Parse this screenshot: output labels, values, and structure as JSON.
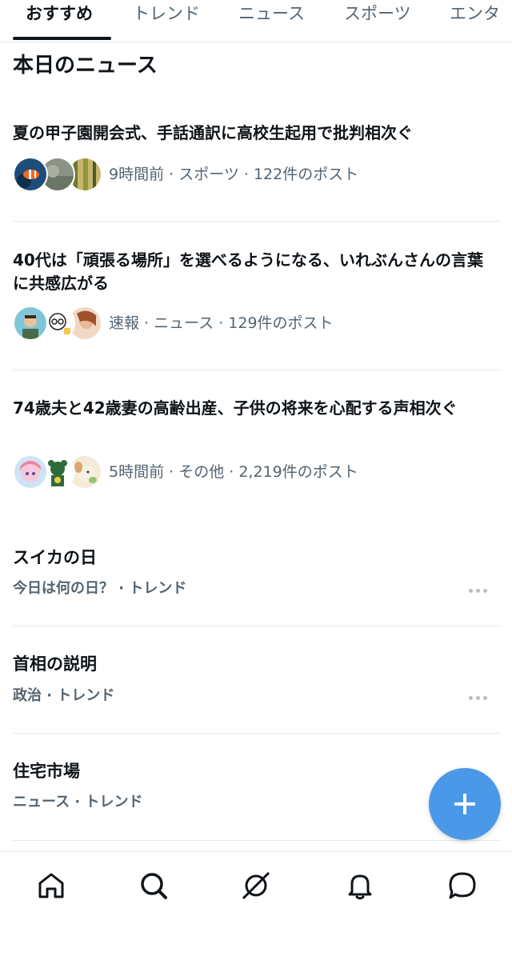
{
  "tabs": [
    {
      "label": "おすすめ"
    },
    {
      "label": "トレンド"
    },
    {
      "label": "ニュース"
    },
    {
      "label": "スポーツ"
    },
    {
      "label": "エンタ"
    }
  ],
  "section_title": "本日のニュース",
  "news": [
    {
      "headline": "夏の甲子園開会式、手話通訳に高校生起用で批判相次ぐ",
      "meta": "9時間前 · スポーツ · 122件のポスト",
      "avatars": [
        "clownfish-avatar",
        "landscape-avatar",
        "bamboo-avatar"
      ]
    },
    {
      "headline": "40代は「頑張る場所」を選べるようになる、いれぶんさんの言葉に共感広がる",
      "meta": "速報 · ニュース · 129件のポスト",
      "avatars": [
        "illustrated-man-avatar",
        "glasses-man-avatar",
        "woman-avatar"
      ]
    },
    {
      "headline": "74歳夫と42歳妻の高齢出産、子供の将来を心配する声相次ぐ",
      "meta": "5時間前 · その他 · 2,219件のポスト",
      "avatars": [
        "anime-girl-avatar",
        "bear-mascot-avatar",
        "dog-character-avatar"
      ]
    }
  ],
  "trends": [
    {
      "title": "スイカの日",
      "meta": "今日は何の日？ · トレンド"
    },
    {
      "title": "首相の説明",
      "meta": "政治 · トレンド"
    },
    {
      "title": "住宅市場",
      "meta": "ニュース · トレンド"
    }
  ],
  "fab": {
    "icon": "plus-icon"
  },
  "bottom_nav": [
    {
      "icon": "home-icon"
    },
    {
      "icon": "search-icon"
    },
    {
      "icon": "grok-icon"
    },
    {
      "icon": "bell-icon"
    },
    {
      "icon": "message-icon"
    }
  ],
  "colors": {
    "text": "#0f1419",
    "secondary": "#536471",
    "accent": "#4a99e9",
    "divider": "#e6e9eb"
  }
}
